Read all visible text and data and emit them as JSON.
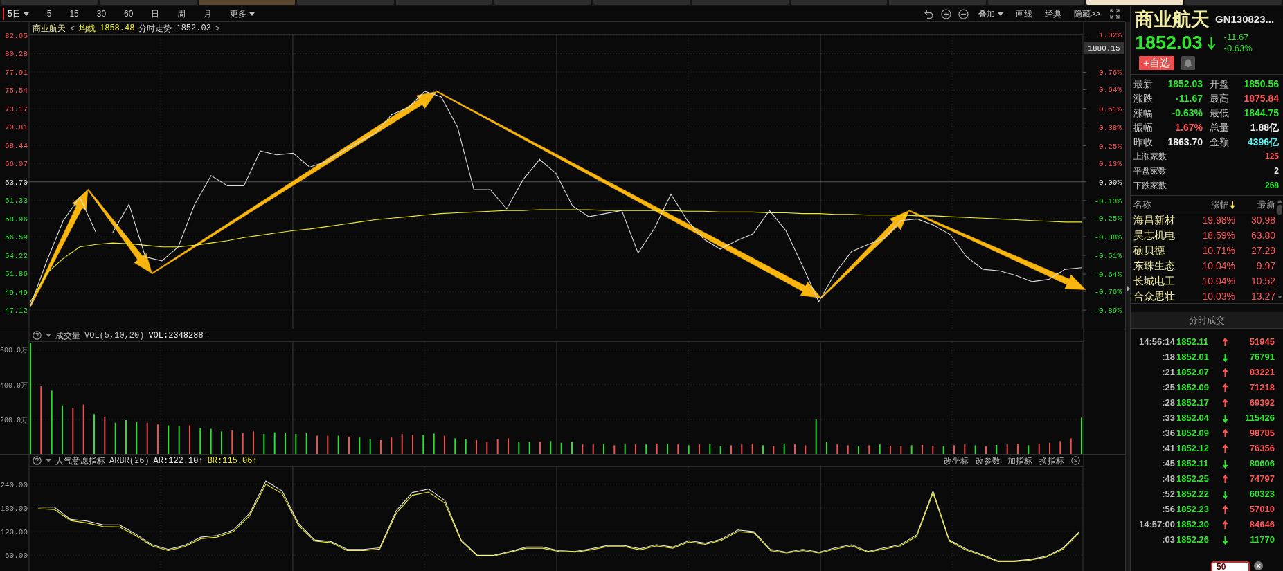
{
  "top_tabs": [
    {
      "selected": false,
      "highlighted": false
    },
    {
      "selected": false,
      "highlighted": false
    },
    {
      "selected": false,
      "highlighted": true
    },
    {
      "selected": false,
      "highlighted": false
    },
    {
      "selected": false,
      "highlighted": false
    },
    {
      "selected": false,
      "highlighted": false
    },
    {
      "selected": false,
      "highlighted": false
    },
    {
      "selected": false,
      "highlighted": false
    },
    {
      "selected": false,
      "highlighted": false
    },
    {
      "selected": false,
      "highlighted": false
    },
    {
      "selected": false,
      "highlighted": false
    },
    {
      "selected": true,
      "highlighted": false
    },
    {
      "selected": false,
      "highlighted": false
    }
  ],
  "toolbar": {
    "periods": [
      {
        "label": "5日",
        "kind": "dropdown",
        "selected": true
      },
      {
        "label": "5",
        "kind": "button",
        "selected": false
      },
      {
        "label": "15",
        "kind": "button",
        "selected": false
      },
      {
        "label": "30",
        "kind": "button",
        "selected": false
      },
      {
        "label": "60",
        "kind": "button",
        "selected": false
      },
      {
        "label": "日",
        "kind": "button",
        "selected": false
      },
      {
        "label": "周",
        "kind": "button",
        "selected": false
      },
      {
        "label": "月",
        "kind": "button",
        "selected": false
      },
      {
        "label": "更多",
        "kind": "dropdown",
        "selected": false
      }
    ],
    "tools": [
      {
        "label": "叠加",
        "kind": "dropdown"
      },
      {
        "label": "画线",
        "kind": "button"
      },
      {
        "label": "经典",
        "kind": "button"
      },
      {
        "label": "隐藏>>",
        "kind": "button"
      }
    ]
  },
  "price_panel": {
    "title": "商业航天",
    "legend_open": "<",
    "legend_close": ">",
    "legend": [
      {
        "value": "1858.48"
      },
      {
        "value": "1852.03"
      }
    ],
    "cursor_label": "1880.15",
    "chart_data": {
      "type": "line",
      "grid": true,
      "ylim": [
        44.71,
        84.35
      ],
      "y2lim": [
        -1.019,
        1.108
      ],
      "yticks": [
        {
          "value": 82.65,
          "label": "82.65"
        },
        {
          "value": 80.28,
          "label": "80.28"
        },
        {
          "value": 77.91,
          "label": "77.91"
        },
        {
          "value": 75.54,
          "label": "75.54"
        },
        {
          "value": 73.17,
          "label": "73.17"
        },
        {
          "value": 70.81,
          "label": "70.81"
        },
        {
          "value": 68.44,
          "label": "68.44"
        },
        {
          "value": 66.07,
          "label": "66.07"
        },
        {
          "value": 63.7,
          "label": "63.70"
        },
        {
          "value": 61.33,
          "label": "61.33"
        },
        {
          "value": 58.96,
          "label": "58.96"
        },
        {
          "value": 56.59,
          "label": "56.59"
        },
        {
          "value": 54.22,
          "label": "54.22"
        },
        {
          "value": 51.86,
          "label": "51.86"
        },
        {
          "value": 49.49,
          "label": "49.49"
        },
        {
          "value": 47.12,
          "label": "47.12"
        }
      ],
      "y2ticks": [
        {
          "value": 1.02,
          "label": "1.02%"
        },
        {
          "value": 0.76,
          "label": "0.76%"
        },
        {
          "value": 0.64,
          "label": "0.64%"
        },
        {
          "value": 0.51,
          "label": "0.51%"
        },
        {
          "value": 0.38,
          "label": "0.38%"
        },
        {
          "value": 0.25,
          "label": "0.25%"
        },
        {
          "value": 0.13,
          "label": "0.13%"
        },
        {
          "value": 0,
          "label": "0.00%"
        },
        {
          "value": -0.13,
          "label": "-0.13%"
        },
        {
          "value": -0.25,
          "label": "-0.25%"
        },
        {
          "value": -0.38,
          "label": "-0.38%"
        },
        {
          "value": -0.51,
          "label": "-0.51%"
        },
        {
          "value": -0.64,
          "label": "-0.64%"
        },
        {
          "value": -0.76,
          "label": "-0.76%"
        },
        {
          "value": -0.89,
          "label": "-0.89%"
        }
      ],
      "series": [
        {
          "name": "均线",
          "color": "#f0f020",
          "values": [
            48.2,
            51.9,
            53.8,
            55.3,
            55.6,
            55.8,
            55.7,
            55.5,
            55.3,
            55.3,
            55.5,
            55.8,
            56.1,
            56.5,
            56.8,
            57.1,
            57.4,
            57.6,
            57.9,
            58.2,
            58.5,
            58.8,
            59.0,
            59.2,
            59.4,
            59.6,
            59.7,
            59.8,
            59.9,
            60.0,
            60.0,
            60.1,
            60.1,
            60.1,
            60.1,
            60.0,
            60.0,
            60.0,
            60.0,
            60.0,
            59.9,
            59.9,
            59.8,
            59.8,
            59.8,
            59.7,
            59.7,
            59.6,
            59.6,
            59.5,
            59.5,
            59.4,
            59.4,
            59.4,
            59.3,
            59.3,
            59.2,
            59.1,
            59.0,
            58.9,
            58.8,
            58.7,
            58.6,
            58.5,
            58.5
          ]
        },
        {
          "name": "分时走势",
          "color": "#dcdcdc",
          "values": [
            47.7,
            53.5,
            58.7,
            61.7,
            57.1,
            57.1,
            60.8,
            54.0,
            53.5,
            55.3,
            60.8,
            64.5,
            63.2,
            63.2,
            67.7,
            67.2,
            67.4,
            65.6,
            66.3,
            67.6,
            68.9,
            70.0,
            72.4,
            73.3,
            75.4,
            74.7,
            70.8,
            62.7,
            62.7,
            60.2,
            64.0,
            66.6,
            64.8,
            60.6,
            59.2,
            59.6,
            60.0,
            54.5,
            57.7,
            62.1,
            58.7,
            56.3,
            55.0,
            56.1,
            57.0,
            60.0,
            57.4,
            52.9,
            48.2,
            51.9,
            54.7,
            55.6,
            56.4,
            58.7,
            58.9,
            58.1,
            56.9,
            54.0,
            52.4,
            52.2,
            51.6,
            50.8,
            51.1,
            52.4,
            52.6
          ]
        }
      ]
    }
  },
  "volume_panel": {
    "title": "成交量",
    "params": "VOL(5,10,20)",
    "reading": "VOL:2348288↑",
    "chart_data": {
      "type": "bar",
      "stacked": true,
      "grid": true,
      "ylim": [
        0,
        717
      ],
      "yticks": [
        {
          "value": 600,
          "label": "600.0万"
        },
        {
          "value": 400,
          "label": "400.0万"
        },
        {
          "value": 200,
          "label": "200.0万"
        }
      ],
      "series": [
        {
          "color": "#f05050",
          "values": [
            null,
            390,
            null,
            null,
            265,
            285,
            null,
            215,
            null,
            null,
            null,
            180,
            170,
            null,
            null,
            165,
            null,
            null,
            null,
            135,
            120,
            130,
            null,
            null,
            null,
            null,
            null,
            105,
            105,
            null,
            100,
            null,
            null,
            80,
            95,
            115,
            110,
            null,
            null,
            105,
            null,
            null,
            80,
            70,
            85,
            90,
            null,
            null,
            72,
            null,
            null,
            null,
            55,
            55,
            null,
            50,
            null,
            55,
            null,
            60,
            null,
            55,
            null,
            55,
            null,
            null,
            50,
            55,
            60,
            null,
            45,
            null,
            55,
            50,
            null,
            null,
            55,
            50,
            null,
            50,
            null,
            48,
            45,
            null,
            52,
            48,
            null,
            50,
            55,
            null,
            45,
            null,
            55,
            60,
            null,
            58,
            65,
            75,
            90,
            null
          ]
        },
        {
          "color": "#2ee02e",
          "values": [
            640,
            null,
            365,
            280,
            null,
            null,
            230,
            null,
            180,
            195,
            185,
            null,
            null,
            165,
            160,
            null,
            150,
            145,
            130,
            null,
            null,
            null,
            115,
            125,
            120,
            115,
            120,
            null,
            null,
            105,
            null,
            95,
            85,
            null,
            null,
            null,
            null,
            110,
            118,
            null,
            90,
            85,
            null,
            null,
            null,
            null,
            70,
            70,
            null,
            75,
            65,
            70,
            null,
            null,
            58,
            null,
            55,
            null,
            55,
            null,
            58,
            null,
            50,
            null,
            58,
            45,
            null,
            null,
            null,
            50,
            null,
            60,
            null,
            null,
            200,
            70,
            null,
            null,
            45,
            null,
            55,
            null,
            null,
            50,
            null,
            null,
            45,
            null,
            null,
            50,
            null,
            52,
            null,
            null,
            50,
            null,
            null,
            null,
            null,
            210
          ]
        }
      ]
    }
  },
  "arbr_panel": {
    "title": "人气意愿指标",
    "params": "ARBR(26)",
    "legend": [
      {
        "value": ":122.10↑"
      },
      {
        "value": ":115.06↑"
      }
    ],
    "actions": [
      "改坐标",
      "改参数",
      "加指标",
      "换指标"
    ],
    "chart_data": {
      "type": "line",
      "grid": true,
      "ylim": [
        20.4,
        314.6
      ],
      "yticks": [
        {
          "value": 240,
          "label": "240.00"
        },
        {
          "value": 180,
          "label": "180.00"
        },
        {
          "value": 120,
          "label": "120.00"
        },
        {
          "value": 60,
          "label": "60.00"
        }
      ],
      "series": [
        {
          "name": "AR",
          "color": "#e8e8e8",
          "values": [
            182,
            182,
            151,
            147,
            137,
            137,
            114,
            87,
            75,
            85,
            106,
            110,
            124,
            166,
            248,
            223,
            141,
            99,
            95,
            75,
            75,
            79,
            172,
            219,
            228,
            199,
            99,
            60,
            60,
            70,
            81,
            81,
            72,
            70,
            77,
            85,
            85,
            77,
            87,
            81,
            97,
            91,
            101,
            124,
            120,
            75,
            68,
            75,
            68,
            79,
            87,
            70,
            79,
            87,
            112,
            223,
            99,
            77,
            62,
            46,
            46,
            50,
            58,
            79,
            120
          ]
        },
        {
          "name": "BR",
          "color": "#f0f020",
          "values": [
            178,
            176,
            148,
            142,
            133,
            132,
            110,
            84,
            72,
            82,
            102,
            106,
            120,
            160,
            240,
            216,
            136,
            96,
            92,
            72,
            72,
            76,
            166,
            212,
            220,
            192,
            96,
            58,
            58,
            68,
            78,
            78,
            70,
            68,
            74,
            82,
            82,
            74,
            84,
            78,
            94,
            88,
            98,
            120,
            117,
            72,
            66,
            72,
            66,
            76,
            84,
            68,
            76,
            84,
            108,
            218,
            96,
            74,
            60,
            44,
            44,
            48,
            56,
            76,
            117
          ]
        }
      ]
    }
  },
  "quote": {
    "name": "商业航天",
    "code": "GN130823...",
    "price": "1852.03",
    "falling": true,
    "change": "-11.67",
    "change_pct": "-0.63%",
    "add_button": "+自选"
  },
  "stats": [
    {
      "label": "最新",
      "value": "1852.03",
      "color": "#2ee62e"
    },
    {
      "label": "开盘",
      "value": "1850.56",
      "color": "#2ee62e"
    },
    {
      "label": "涨跌",
      "value": "-11.67",
      "color": "#2ee62e"
    },
    {
      "label": "最高",
      "value": "1875.84",
      "color": "#ff5454"
    },
    {
      "label": "涨幅",
      "value": "-0.63%",
      "color": "#2ee62e"
    },
    {
      "label": "最低",
      "value": "1844.75",
      "color": "#2ee62e"
    },
    {
      "label": "振幅",
      "value": "1.67%",
      "color": "#ff5454"
    },
    {
      "label": "总量",
      "value": "1.88亿",
      "color": "#f0f0f0"
    },
    {
      "label": "昨收",
      "value": "1863.70",
      "color": "#f0f0f0"
    },
    {
      "label": "金额",
      "value": "4396亿",
      "color": "#5ef0f0"
    }
  ],
  "breadth": [
    {
      "label": "上涨家数",
      "value": "125",
      "color": "#ff5454"
    },
    {
      "label": "平盘家数",
      "value": "2",
      "color": "#f0f0f0"
    },
    {
      "label": "下跌家数",
      "value": "268",
      "color": "#2ee62e"
    }
  ],
  "constituents": {
    "columns": [
      {
        "label": "名称",
        "sorted": false
      },
      {
        "label": "涨幅",
        "sorted": true
      },
      {
        "label": "最新",
        "sorted": false
      }
    ],
    "rows": [
      {
        "name": "海昌新材",
        "change": "19.98%",
        "price": "30.98"
      },
      {
        "name": "昊志机电",
        "change": "18.59%",
        "price": "63.80"
      },
      {
        "name": "硕贝德",
        "change": "10.71%",
        "price": "27.29"
      },
      {
        "name": "东珠生态",
        "change": "10.04%",
        "price": "9.97"
      },
      {
        "name": "长城电工",
        "change": "10.04%",
        "price": "10.52"
      },
      {
        "name": "合众思壮",
        "change": "10.03%",
        "price": "13.27"
      }
    ]
  },
  "trades": {
    "title": "分时成交",
    "rows": [
      {
        "time": "14:56:14",
        "price": "1852.11",
        "uptick": true,
        "volume": "51945"
      },
      {
        "time": ":18",
        "price": "1852.01",
        "uptick": false,
        "volume": "76791"
      },
      {
        "time": ":21",
        "price": "1852.07",
        "uptick": true,
        "volume": "83221"
      },
      {
        "time": ":25",
        "price": "1852.09",
        "uptick": true,
        "volume": "71218"
      },
      {
        "time": ":28",
        "price": "1852.17",
        "uptick": true,
        "volume": "69392"
      },
      {
        "time": ":33",
        "price": "1852.04",
        "uptick": false,
        "volume": "115426"
      },
      {
        "time": ":36",
        "price": "1852.09",
        "uptick": true,
        "volume": "98785"
      },
      {
        "time": ":41",
        "price": "1852.12",
        "uptick": true,
        "volume": "76356"
      },
      {
        "time": ":45",
        "price": "1852.11",
        "uptick": false,
        "volume": "80606"
      },
      {
        "time": ":48",
        "price": "1852.25",
        "uptick": true,
        "volume": "74797"
      },
      {
        "time": ":52",
        "price": "1852.22",
        "uptick": false,
        "volume": "60323"
      },
      {
        "time": ":56",
        "price": "1852.23",
        "uptick": true,
        "volume": "57010"
      },
      {
        "time": "14:57:00",
        "price": "1852.30",
        "uptick": true,
        "volume": "84646"
      },
      {
        "time": ":03",
        "price": "1852.26",
        "uptick": false,
        "volume": "11770"
      }
    ]
  },
  "popup": {
    "text": "50"
  }
}
